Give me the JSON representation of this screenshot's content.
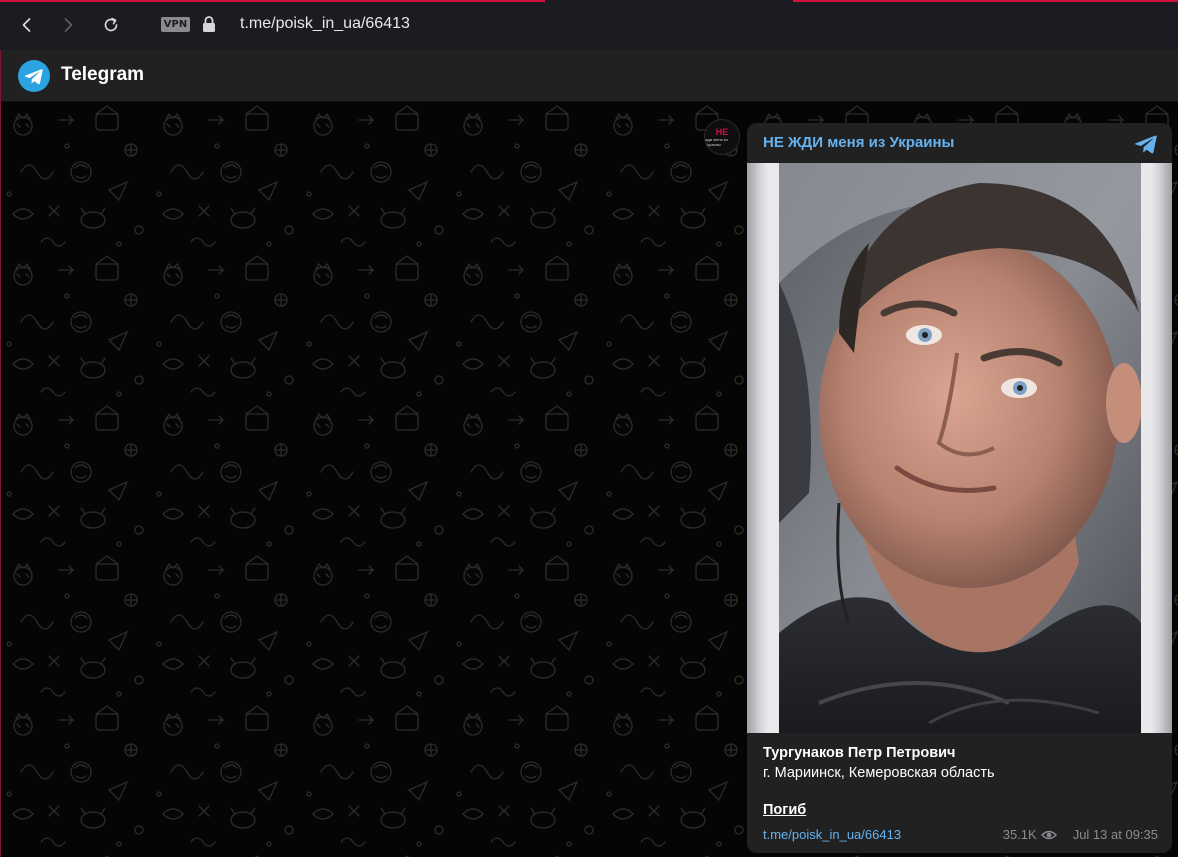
{
  "browser": {
    "vpn_label": "VPN",
    "url": "t.me/poisk_in_ua/66413",
    "icons": [
      "back-icon",
      "forward-icon",
      "reload-icon",
      "lock-icon"
    ]
  },
  "header": {
    "app_name": "Telegram"
  },
  "message": {
    "channel_name": "НЕ ЖДИ меня из Украины",
    "avatar_text": "НЕ",
    "avatar_sub": "жди меня из Украины",
    "name": "Тургунаков Петр Петрович",
    "location": "г. Мариинск, Кемеровская область",
    "status": "Погиб",
    "link": "t.me/poisk_in_ua/66413",
    "views": "35.1K",
    "time": "Jul 13 at 09:35"
  },
  "colors": {
    "accent_link": "#66b2ee",
    "browser_accent": "#d0113f",
    "card_bg": "#212121"
  }
}
